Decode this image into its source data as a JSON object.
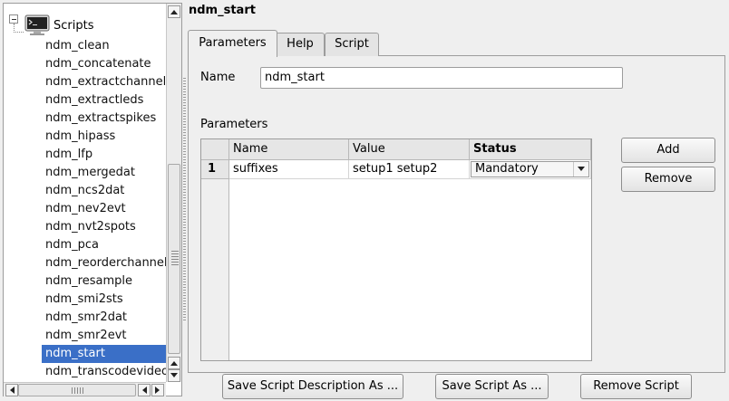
{
  "tree": {
    "root_label": "Scripts",
    "items": [
      {
        "label": "ndm_clean"
      },
      {
        "label": "ndm_concatenate"
      },
      {
        "label": "ndm_extractchannels"
      },
      {
        "label": "ndm_extractleds"
      },
      {
        "label": "ndm_extractspikes"
      },
      {
        "label": "ndm_hipass"
      },
      {
        "label": "ndm_lfp"
      },
      {
        "label": "ndm_mergedat"
      },
      {
        "label": "ndm_ncs2dat"
      },
      {
        "label": "ndm_nev2evt"
      },
      {
        "label": "ndm_nvt2spots"
      },
      {
        "label": "ndm_pca"
      },
      {
        "label": "ndm_reorderchannels"
      },
      {
        "label": "ndm_resample"
      },
      {
        "label": "ndm_smi2sts"
      },
      {
        "label": "ndm_smr2dat"
      },
      {
        "label": "ndm_smr2evt"
      },
      {
        "label": "ndm_start",
        "selected": true
      },
      {
        "label": "ndm_transcodevideo"
      }
    ]
  },
  "script_title": "ndm_start",
  "tabs": [
    {
      "label": "Parameters",
      "active": true
    },
    {
      "label": "Help"
    },
    {
      "label": "Script"
    }
  ],
  "form": {
    "name_label": "Name",
    "name_value": "ndm_start",
    "params_label": "Parameters"
  },
  "table": {
    "headers": [
      "Name",
      "Value",
      "Status"
    ],
    "rows": [
      {
        "num": "1",
        "name": "suffixes",
        "value": "setup1 setup2",
        "status": "Mandatory"
      }
    ]
  },
  "buttons": {
    "add": "Add",
    "remove": "Remove",
    "save_description": "Save Script Description As ...",
    "save_script_as": "Save Script As ...",
    "remove_script": "Remove Script"
  },
  "icons": {
    "root": "terminal-icon",
    "expander": "collapse-icon"
  },
  "colors": {
    "selection": "#3a6fc7"
  }
}
